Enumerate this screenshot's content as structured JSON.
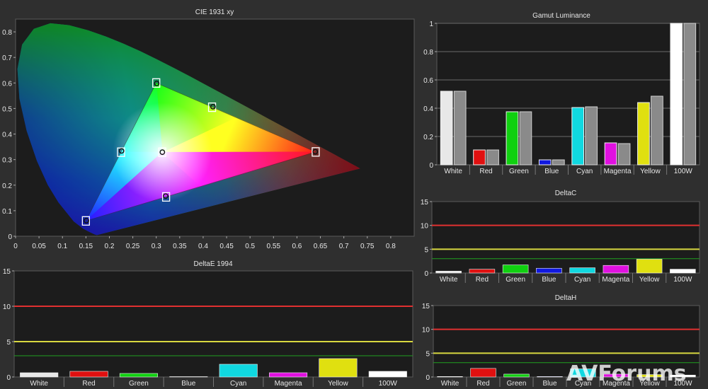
{
  "watermark": "AVForums",
  "colors": {
    "White": "#e8e8e8",
    "Red": "#e01010",
    "Green": "#10d010",
    "Blue": "#1018e0",
    "Cyan": "#10d8e0",
    "Magenta": "#e010e0",
    "Yellow": "#e0e010",
    "100W": "#ffffff",
    "reference": "#8a8a8a",
    "threshold_high": "#e03030",
    "threshold_mid": "#d8d840",
    "threshold_low": "#20a020"
  },
  "chart_data": [
    {
      "id": "cie",
      "type": "scatter",
      "title": "CIE 1931 xy",
      "xlim": [
        0,
        0.85
      ],
      "ylim": [
        0,
        0.85
      ],
      "xticks": [
        "0",
        "0.05",
        "0.1",
        "0.15",
        "0.2",
        "0.25",
        "0.3",
        "0.35",
        "0.4",
        "0.45",
        "0.5",
        "0.55",
        "0.6",
        "0.65",
        "0.7",
        "0.75",
        "0.8"
      ],
      "yticks": [
        "0",
        "0.1",
        "0.2",
        "0.3",
        "0.4",
        "0.5",
        "0.6",
        "0.7",
        "0.8"
      ],
      "gamut_triangle": [
        [
          0.64,
          0.33
        ],
        [
          0.3,
          0.6
        ],
        [
          0.15,
          0.06
        ]
      ],
      "white_point": [
        0.3127,
        0.329
      ],
      "targets": [
        {
          "name": "Red",
          "x": 0.64,
          "y": 0.33
        },
        {
          "name": "Green",
          "x": 0.3,
          "y": 0.6
        },
        {
          "name": "Blue",
          "x": 0.15,
          "y": 0.06
        },
        {
          "name": "Cyan",
          "x": 0.225,
          "y": 0.329
        },
        {
          "name": "Magenta",
          "x": 0.321,
          "y": 0.154
        },
        {
          "name": "Yellow",
          "x": 0.419,
          "y": 0.505
        },
        {
          "name": "White",
          "x": 0.3127,
          "y": 0.329
        }
      ],
      "measured": [
        {
          "name": "Red",
          "x": 0.639,
          "y": 0.331
        },
        {
          "name": "Green",
          "x": 0.301,
          "y": 0.598
        },
        {
          "name": "Blue",
          "x": 0.151,
          "y": 0.061
        },
        {
          "name": "Cyan",
          "x": 0.226,
          "y": 0.334
        },
        {
          "name": "Magenta",
          "x": 0.32,
          "y": 0.157
        },
        {
          "name": "Yellow",
          "x": 0.421,
          "y": 0.507
        },
        {
          "name": "White",
          "x": 0.313,
          "y": 0.329
        }
      ]
    },
    {
      "id": "lum",
      "type": "bar",
      "title": "Gamut Luminance",
      "categories": [
        "White",
        "Red",
        "Green",
        "Blue",
        "Cyan",
        "Magenta",
        "Yellow",
        "100W"
      ],
      "ylim": [
        0,
        1
      ],
      "yticks": [
        "0",
        "0.2",
        "0.4",
        "0.6",
        "0.8",
        "1"
      ],
      "series": [
        {
          "values": [
            0.52,
            0.105,
            0.375,
            0.035,
            0.405,
            0.155,
            0.44,
            1.0
          ]
        },
        {
          "values": [
            0.52,
            0.105,
            0.375,
            0.035,
            0.41,
            0.15,
            0.485,
            1.0
          ]
        }
      ]
    },
    {
      "id": "dc",
      "type": "bar",
      "title": "DeltaC",
      "categories": [
        "White",
        "Red",
        "Green",
        "Blue",
        "Cyan",
        "Magenta",
        "Yellow",
        "100W"
      ],
      "ylim": [
        0,
        15
      ],
      "yticks": [
        "0",
        "5",
        "10",
        "15"
      ],
      "thresholds": [
        10,
        5,
        3
      ],
      "values": [
        0.4,
        0.8,
        1.7,
        1.0,
        1.1,
        1.6,
        2.9,
        0.8
      ]
    },
    {
      "id": "de",
      "type": "bar",
      "title": "DeltaE 1994",
      "categories": [
        "White",
        "Red",
        "Green",
        "Blue",
        "Cyan",
        "Magenta",
        "Yellow",
        "100W"
      ],
      "ylim": [
        0,
        15
      ],
      "yticks": [
        "0",
        "5",
        "10",
        "15"
      ],
      "thresholds": [
        10,
        5,
        3
      ],
      "values": [
        0.6,
        0.8,
        0.5,
        0.05,
        1.8,
        0.6,
        2.6,
        0.8
      ]
    },
    {
      "id": "dh",
      "type": "bar",
      "title": "DeltaH",
      "categories": [
        "White",
        "Red",
        "Green",
        "Blue",
        "Cyan",
        "Magenta",
        "Yellow",
        "100W"
      ],
      "ylim": [
        0,
        15
      ],
      "yticks": [
        "0",
        "5",
        "10",
        "15"
      ],
      "thresholds": [
        10,
        5,
        3
      ],
      "values": [
        0.1,
        1.8,
        0.6,
        0.1,
        1.7,
        0.6,
        0.5,
        0.4
      ]
    }
  ]
}
